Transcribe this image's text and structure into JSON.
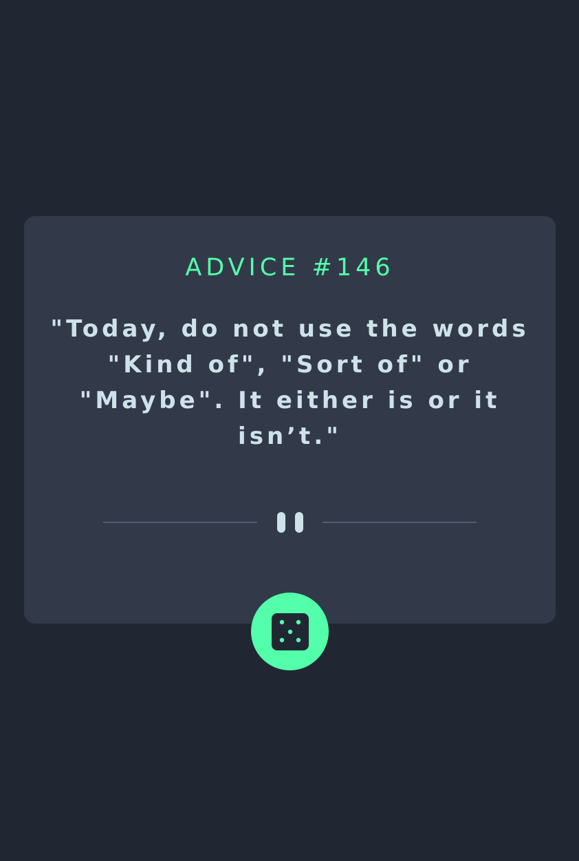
{
  "advice": {
    "heading": "ADVICE #146",
    "text": "\"Today, do not use the words \"Kind of\", \"Sort of\" or \"Maybe\". It either is or it isn’t.\""
  },
  "icons": {
    "divider": "pause-icon",
    "button": "dice-icon"
  },
  "colors": {
    "background": "#202733",
    "card": "#323a49",
    "accent": "#53ffaa",
    "text": "#cee3e9",
    "divider": "#4f5d74"
  }
}
